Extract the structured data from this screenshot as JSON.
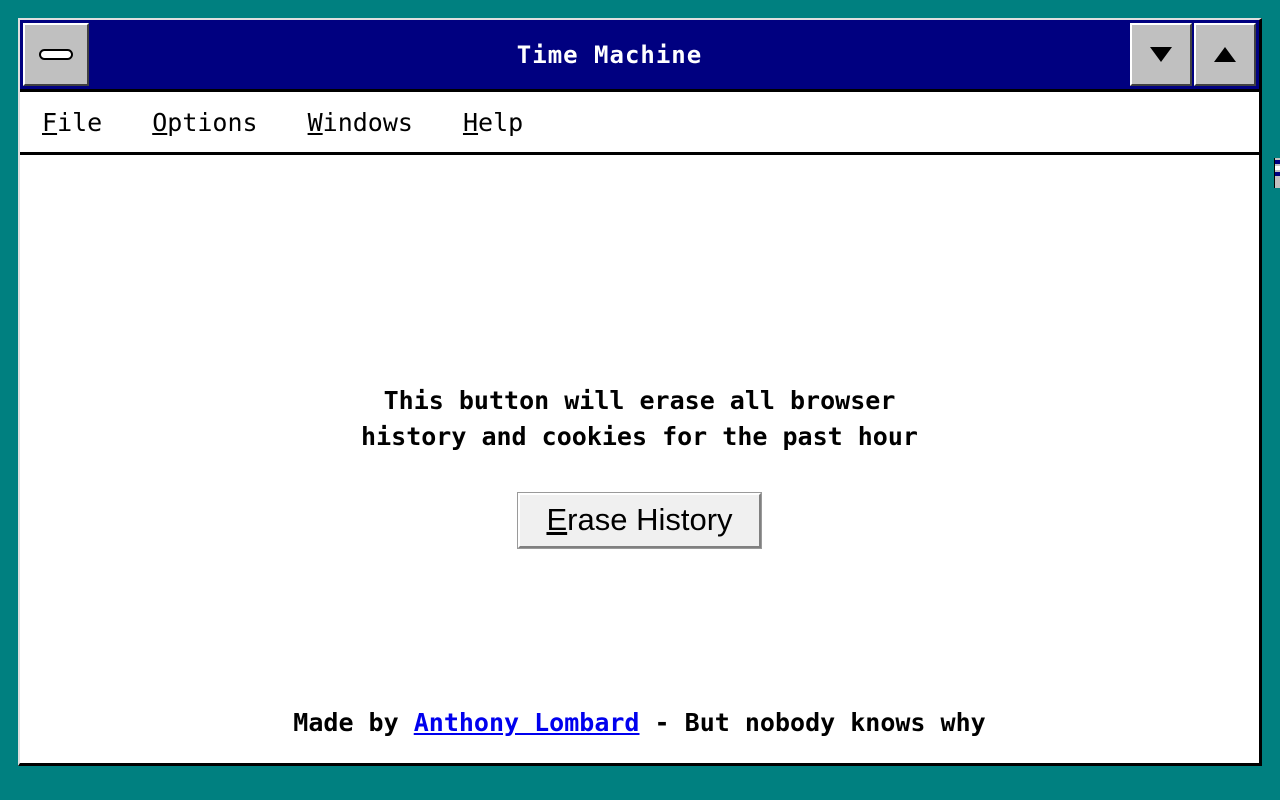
{
  "desktop": {
    "background_color": "#008080"
  },
  "window": {
    "title": "Time Machine",
    "titlebar_color": "#000080",
    "titlebar_text_color": "#ffffff",
    "face_color": "#c0c0c0",
    "client_color": "#ffffff",
    "system_menu_icon": "minimize-pill-icon",
    "buttons": [
      {
        "name": "minimize",
        "icon": "triangle-down-icon",
        "glyph": "▼"
      },
      {
        "name": "maximize",
        "icon": "triangle-up-icon",
        "glyph": "▲"
      }
    ]
  },
  "menubar": {
    "items": [
      {
        "accel": "F",
        "rest": "ile"
      },
      {
        "accel": "O",
        "rest": "ptions"
      },
      {
        "accel": "W",
        "rest": "indows"
      },
      {
        "accel": "H",
        "rest": "elp"
      }
    ]
  },
  "main": {
    "message_lines": [
      "This button will erase all browser",
      "history and cookies for the past hour"
    ],
    "erase_button": {
      "accel": "E",
      "rest": "rase History",
      "full_label": "Erase History"
    }
  },
  "footer": {
    "prefix": "Made by ",
    "link_text": "Anthony Lombard",
    "link_color": "#0000ee",
    "suffix": " - But nobody knows why"
  }
}
